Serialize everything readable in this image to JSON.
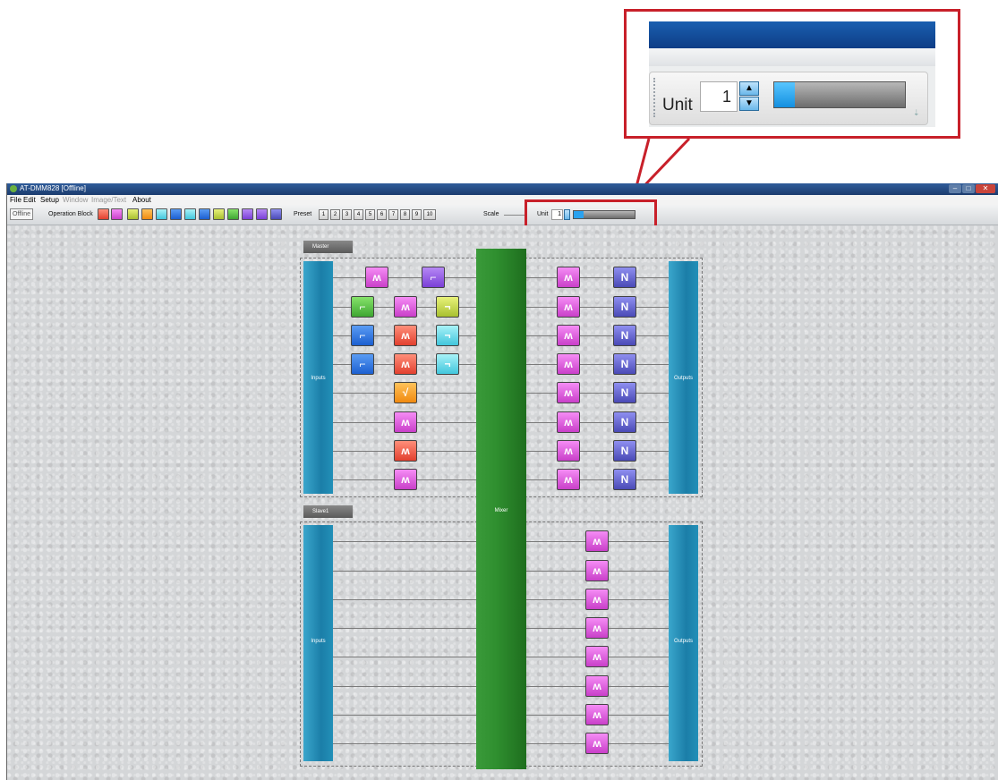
{
  "callout": {
    "unit_label": "Unit",
    "unit_value": "1",
    "level_fraction": 0.16,
    "accent_color": "#c8202a"
  },
  "window": {
    "title": "AT-DMM828 [Offline]",
    "buttons": [
      "minimize-icon",
      "maximize-icon",
      "close-icon"
    ]
  },
  "menu": [
    "File",
    "Edit",
    "Setup",
    "Window",
    "Image/Text",
    "About"
  ],
  "toolbar": {
    "offline_label": "Offline",
    "operation_block_label": "Operation Block",
    "operation_icons": [
      "level-icon",
      "level-icon",
      "level-icon",
      "eq-icon",
      "gate-icon",
      "filter-icon",
      "filter-icon",
      "filter-icon",
      "filter-icon",
      "filter-icon",
      "filter-icon",
      "filter-icon",
      "filter-icon"
    ],
    "preset_label": "Preset",
    "presets": [
      "1",
      "2",
      "3",
      "4",
      "5",
      "6",
      "7",
      "8",
      "9",
      "10"
    ],
    "scale_label": "Scale",
    "unit_label": "Unit",
    "unit_value": "1"
  },
  "groups": [
    {
      "tag": "Master",
      "inputs_label": "Inputs",
      "outputs_label": "Outputs"
    },
    {
      "tag": "Slave1",
      "inputs_label": "Inputs",
      "outputs_label": "Outputs"
    }
  ],
  "mixer_label": "Mixer"
}
